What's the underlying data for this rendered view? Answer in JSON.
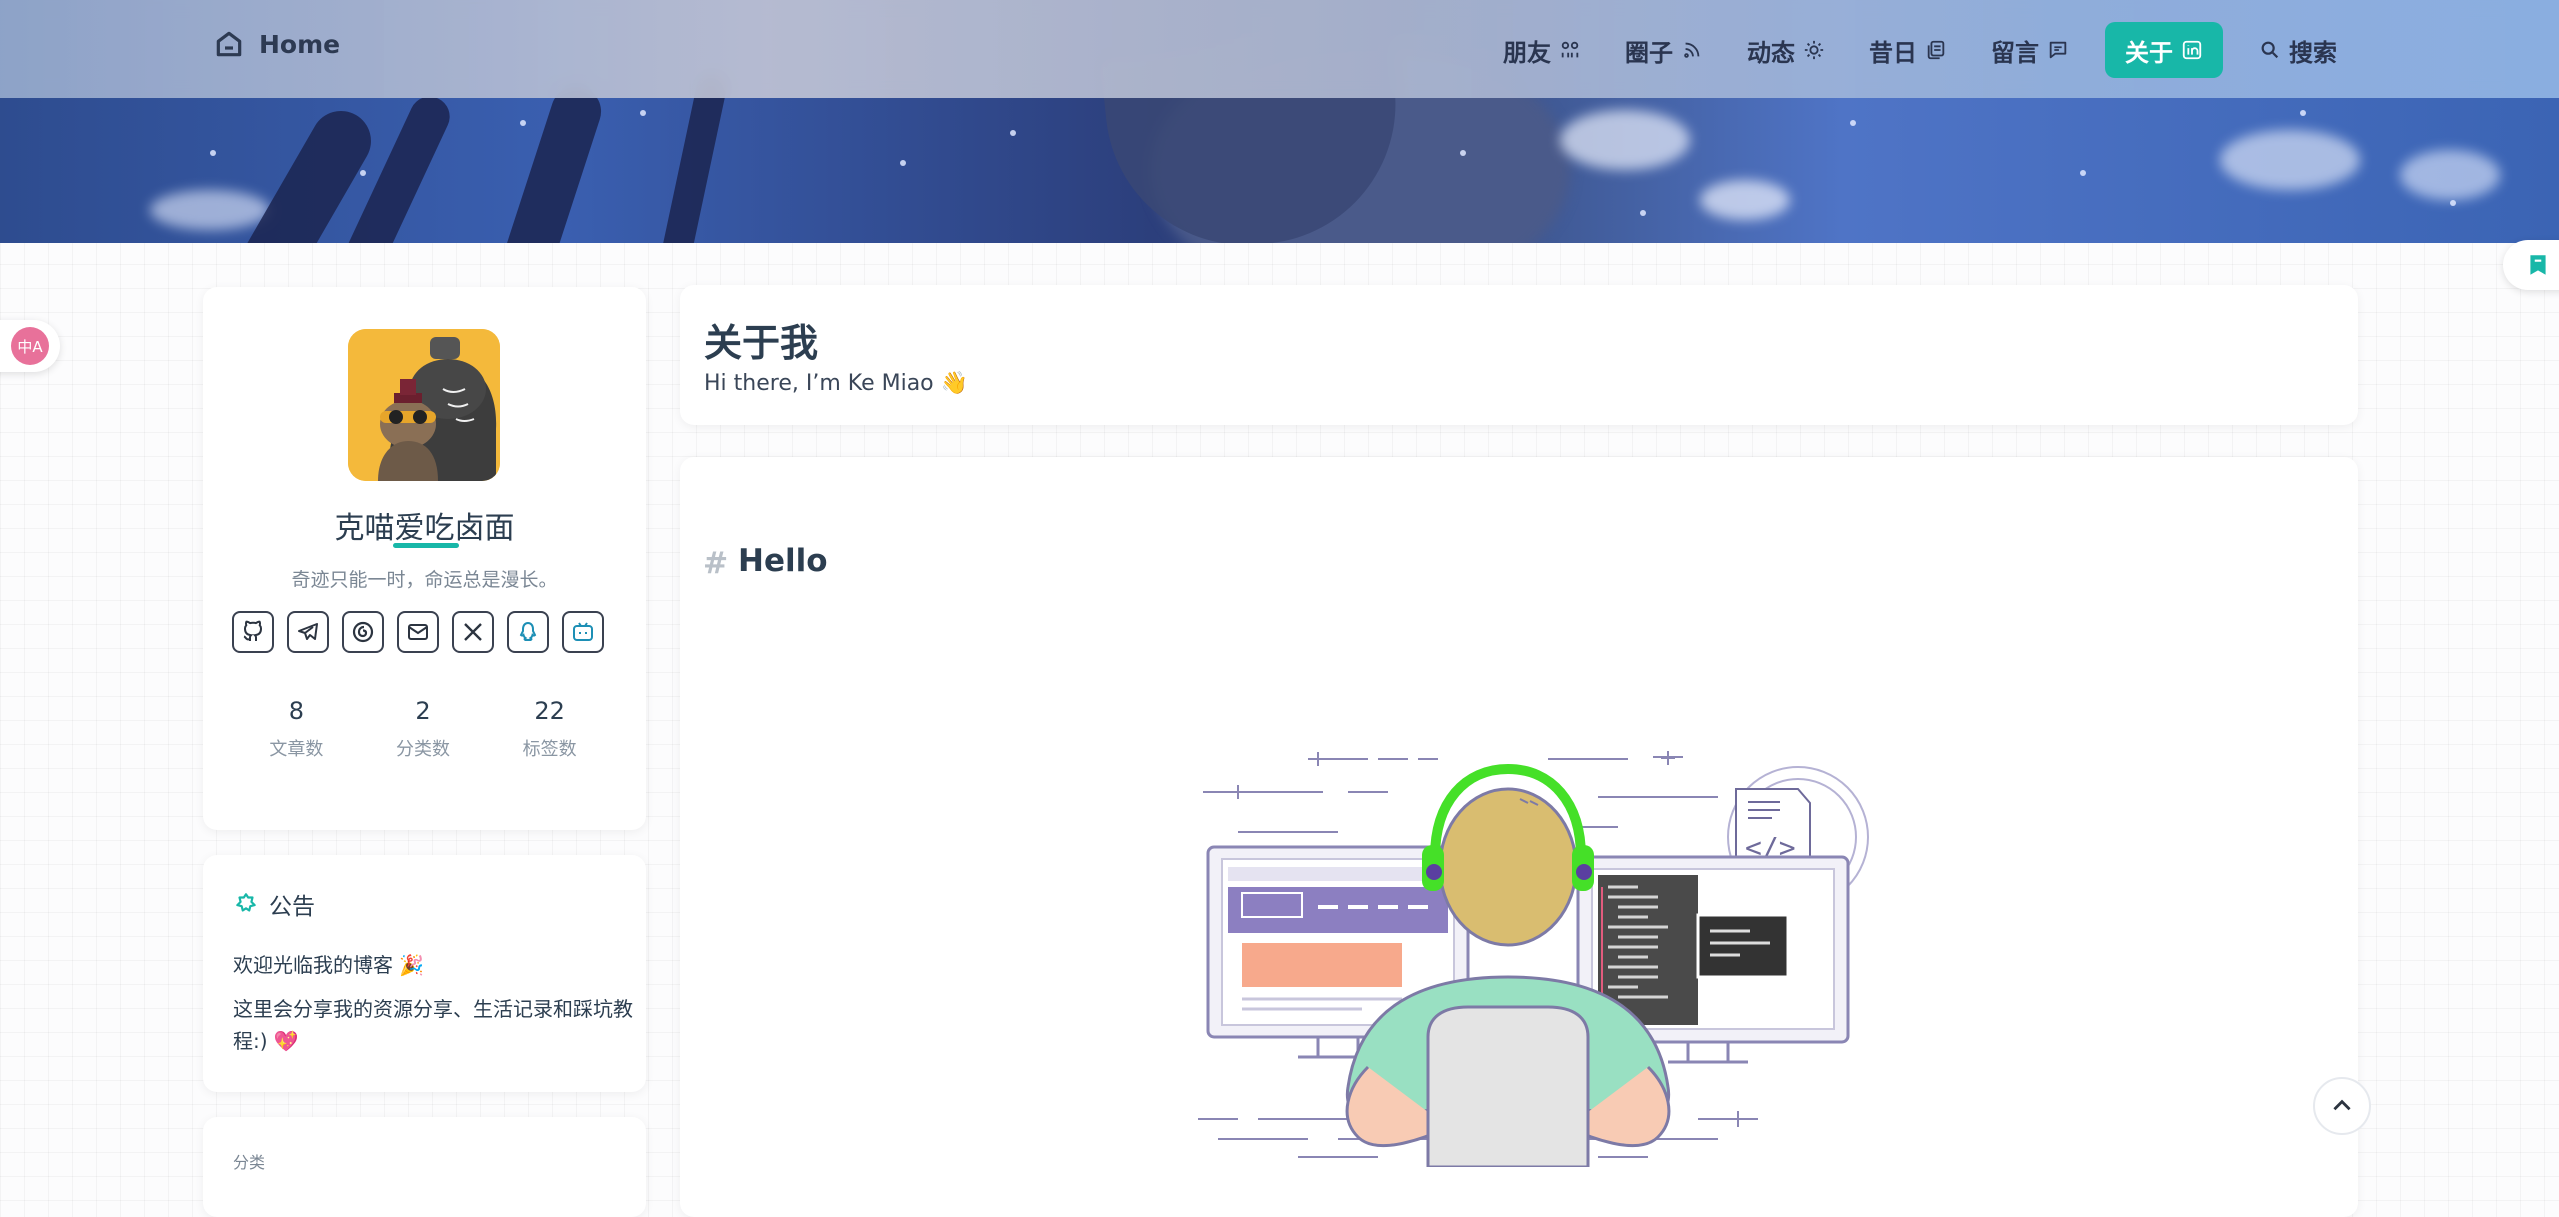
{
  "header": {
    "brand_label": "Home",
    "nav": [
      {
        "label": "朋友",
        "icon": "users-icon"
      },
      {
        "label": "圈子",
        "icon": "rss-icon"
      },
      {
        "label": "动态",
        "icon": "sun-icon"
      },
      {
        "label": "昔日",
        "icon": "archive-icon"
      },
      {
        "label": "留言",
        "icon": "message-icon"
      },
      {
        "label": "关于",
        "icon": "linkedin-icon",
        "active": true
      },
      {
        "label": "搜索",
        "icon": "search-icon"
      }
    ],
    "accent_color": "#18b7a8"
  },
  "profile": {
    "name": "克喵爱吃卤面",
    "motto": "奇迹只能一时，命运总是漫长。",
    "socials": [
      "github-icon",
      "telegram-icon",
      "netease-music-icon",
      "mail-icon",
      "x-icon",
      "qq-icon",
      "bilibili-icon"
    ],
    "stats": [
      {
        "value": "8",
        "label": "文章数"
      },
      {
        "value": "2",
        "label": "分类数"
      },
      {
        "value": "22",
        "label": "标签数"
      }
    ]
  },
  "notice": {
    "title": "公告",
    "line1": "欢迎光临我的博客 🎉",
    "line2": "这里会分享我的资源分享、生活记录和踩坑教程:) 💖"
  },
  "categories": {
    "title": "分类"
  },
  "about": {
    "title": "关于我",
    "subtitle": "Hi there, I’m Ke Miao 👋"
  },
  "content": {
    "hash": "#",
    "heading": "Hello"
  },
  "widgets": {
    "translate_label": "中A"
  }
}
